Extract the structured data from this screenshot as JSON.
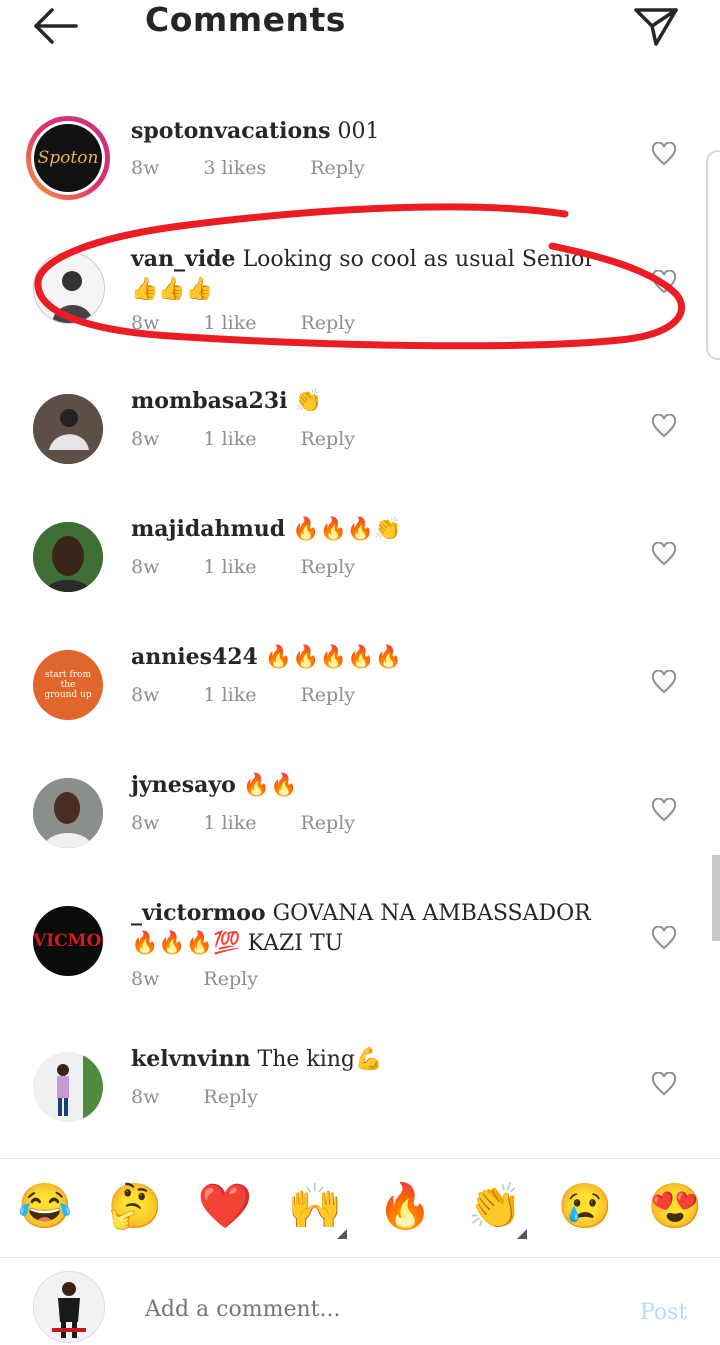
{
  "header": {
    "title": "Comments",
    "back_icon": "arrow-left-icon",
    "direct_icon": "paper-plane-icon"
  },
  "comments": [
    {
      "user": "spotonvacations",
      "text": "001",
      "time": "8w",
      "likes": "3 likes",
      "reply": "Reply",
      "avatar_text": "Spoton"
    },
    {
      "user": "van_vide",
      "text": "Looking so cool as usual Senior 👍👍👍",
      "time": "8w",
      "likes": "1 like",
      "reply": "Reply"
    },
    {
      "user": "mombasa23i",
      "text": "👏",
      "time": "8w",
      "likes": "1 like",
      "reply": "Reply"
    },
    {
      "user": "majidahmud",
      "text": "🔥🔥🔥👏",
      "time": "8w",
      "likes": "1 like",
      "reply": "Reply"
    },
    {
      "user": "annies424",
      "text": "🔥🔥🔥🔥🔥",
      "time": "8w",
      "likes": "1 like",
      "reply": "Reply",
      "avatar_text": "start from the ground up"
    },
    {
      "user": "jynesayo",
      "text": "🔥🔥",
      "time": "8w",
      "likes": "1 like",
      "reply": "Reply"
    },
    {
      "user": "_victormoo",
      "text": "GOVANA NA AMBASSADOR 🔥🔥🔥💯 KAZI TU",
      "time": "8w",
      "likes": "",
      "reply": "Reply",
      "avatar_text": "VICMOO"
    },
    {
      "user": "kelvnvinn",
      "text": "The king💪",
      "time": "8w",
      "likes": "",
      "reply": "Reply"
    }
  ],
  "emoji_bar": [
    "😂",
    "🤔",
    "❤️",
    "🙌",
    "🔥",
    "👏",
    "😢",
    "😍"
  ],
  "composer": {
    "placeholder": "Add a comment...",
    "post_label": "Post"
  },
  "colors": {
    "annotation": "#ec1c24",
    "meta_gray": "#8e8e8e",
    "post_blue": "#b6dcf5"
  }
}
